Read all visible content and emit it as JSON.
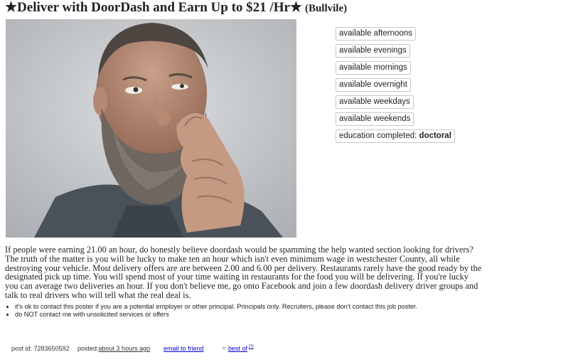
{
  "header": {
    "title": "★Deliver with DoorDash and Earn Up to $21 /Hr★",
    "location": "(Bullvile)"
  },
  "photo": {
    "description_icon": "photo-of-bearded-man"
  },
  "attributes": [
    {
      "text": "available afternoons"
    },
    {
      "text": "available evenings"
    },
    {
      "text": "available mornings"
    },
    {
      "text": "available overnight"
    },
    {
      "text": "available weekdays"
    },
    {
      "text": "available weekends"
    },
    {
      "label": "education completed: ",
      "value": "doctoral"
    }
  ],
  "body": {
    "text": "If people were earning 21.00 an hour, do honestly believe doordash would be spamming the help wanted section looking for drivers? The truth of the matter is you will be lucky to make ten an hour which isn't even minimum wage in westchester County, all while destroying your vehicle. Most delivery offers are are between 2.00 and 6.00 per delivery. Restaurants rarely have the good ready by the designated pick up time. You will spend most of your time waiting in restaurants for the food you will be delivering. If you're lucky you can average two deliveries an hour. If you don't believe me, go onto Facebook and join a few doordash delivery driver groups and talk to real drivers who will tell what the real deal is."
  },
  "notices": [
    "it's ok to contact this poster if you are a potential employer or other principal. Principals only. Recruiters, please don't contact this job poster.",
    "do NOT contact me with unsolicited services or offers"
  ],
  "footer": {
    "post_id": "post id: 7283650592",
    "posted_label": "posted: ",
    "posted_value": "about 3 hours ago",
    "email_link": "email to friend",
    "best_of": "best of",
    "best_of_sup": "[?]"
  },
  "colors": {
    "link": "#0000cc",
    "text": "#222222",
    "border": "#c8c8c8"
  }
}
